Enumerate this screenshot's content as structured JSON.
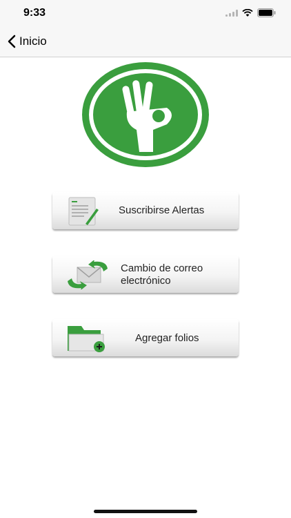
{
  "status_bar": {
    "time": "9:33"
  },
  "nav": {
    "back_label": "Inicio"
  },
  "menu": {
    "items": [
      {
        "label": "Suscribirse Alertas",
        "icon": "document-pen-icon"
      },
      {
        "label": "Cambio de correo electrónico",
        "icon": "email-refresh-icon"
      },
      {
        "label": "Agregar folios",
        "icon": "folder-add-icon"
      }
    ]
  },
  "colors": {
    "brand_green": "#3a9e3e",
    "button_face": "#f4f4f4"
  }
}
